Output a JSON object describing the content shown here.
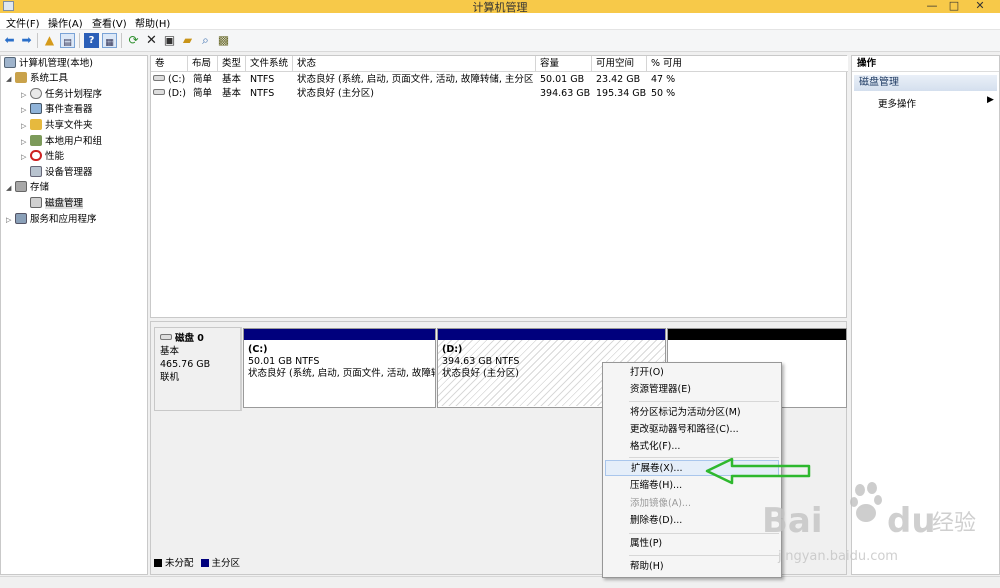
{
  "window": {
    "title": "计算机管理",
    "minimize_glyph": "—",
    "maximize_glyph": "□",
    "close_glyph": "✕"
  },
  "menu": [
    "文件(F)",
    "操作(A)",
    "查看(V)",
    "帮助(H)"
  ],
  "toolbar_icons": [
    "back-arrow-icon",
    "forward-arrow-icon",
    "up-folder-icon",
    "show-hide-tree-icon",
    "help-icon",
    "console-icon",
    "refresh-icon",
    "delete-icon",
    "properties-icon",
    "open-folder-icon",
    "search-icon",
    "export-icon"
  ],
  "tree": {
    "root": "计算机管理(本地)",
    "system_tools": "系统工具",
    "task_scheduler": "任务计划程序",
    "event_viewer": "事件查看器",
    "shared_folders": "共享文件夹",
    "local_users": "本地用户和组",
    "performance": "性能",
    "device_manager": "设备管理器",
    "storage": "存储",
    "disk_management": "磁盘管理",
    "services_apps": "服务和应用程序"
  },
  "volume_list": {
    "columns": [
      "卷",
      "布局",
      "类型",
      "文件系统",
      "状态",
      "容量",
      "可用空间",
      "% 可用"
    ],
    "rows": [
      {
        "volume": "(C:)",
        "layout": "简单",
        "type": "基本",
        "fs": "NTFS",
        "status": "状态良好 (系统, 启动, 页面文件, 活动, 故障转储, 主分区)",
        "capacity": "50.01 GB",
        "free": "23.42 GB",
        "pct": "47 %"
      },
      {
        "volume": "(D:)",
        "layout": "简单",
        "type": "基本",
        "fs": "NTFS",
        "status": "状态良好 (主分区)",
        "capacity": "394.63 GB",
        "free": "195.34 GB",
        "pct": "50 %"
      }
    ]
  },
  "disk": {
    "name": "磁盘 0",
    "type": "基本",
    "size": "465.76 GB",
    "state": "联机",
    "partitions": [
      {
        "label": "(C:)",
        "size": "50.01 GB NTFS",
        "status": "状态良好 (系统, 启动, 页面文件, 活动, 故障转储"
      },
      {
        "label": "(D:)",
        "size": "394.63 GB NTFS",
        "status": "状态良好 (主分区)"
      }
    ]
  },
  "legend": {
    "unallocated": "未分配",
    "primary": "主分区",
    "unallocated_color": "#000000",
    "primary_color": "#00007d"
  },
  "actions_pane": {
    "header": "操作",
    "section": "磁盘管理",
    "more": "更多操作"
  },
  "context_menu": {
    "items": [
      {
        "label": "打开(O)",
        "disabled": false
      },
      {
        "label": "资源管理器(E)",
        "disabled": false
      },
      {
        "label": "将分区标记为活动分区(M)",
        "disabled": false
      },
      {
        "label": "更改驱动器号和路径(C)...",
        "disabled": false
      },
      {
        "label": "格式化(F)...",
        "disabled": false
      },
      {
        "label": "扩展卷(X)...",
        "disabled": false,
        "highlighted": true
      },
      {
        "label": "压缩卷(H)...",
        "disabled": false
      },
      {
        "label": "添加镜像(A)...",
        "disabled": true
      },
      {
        "label": "删除卷(D)...",
        "disabled": false
      },
      {
        "label": "属性(P)",
        "disabled": false
      },
      {
        "label": "帮助(H)",
        "disabled": false
      }
    ]
  },
  "watermark": {
    "brand": "Bai",
    "brand2": "du",
    "cn": "经验",
    "url": "jingyan.baidu.com"
  },
  "colors": {
    "titlebar": "#f7c949",
    "annotation_arrow": "#2eb82e",
    "highlight": "#e5eef9"
  }
}
